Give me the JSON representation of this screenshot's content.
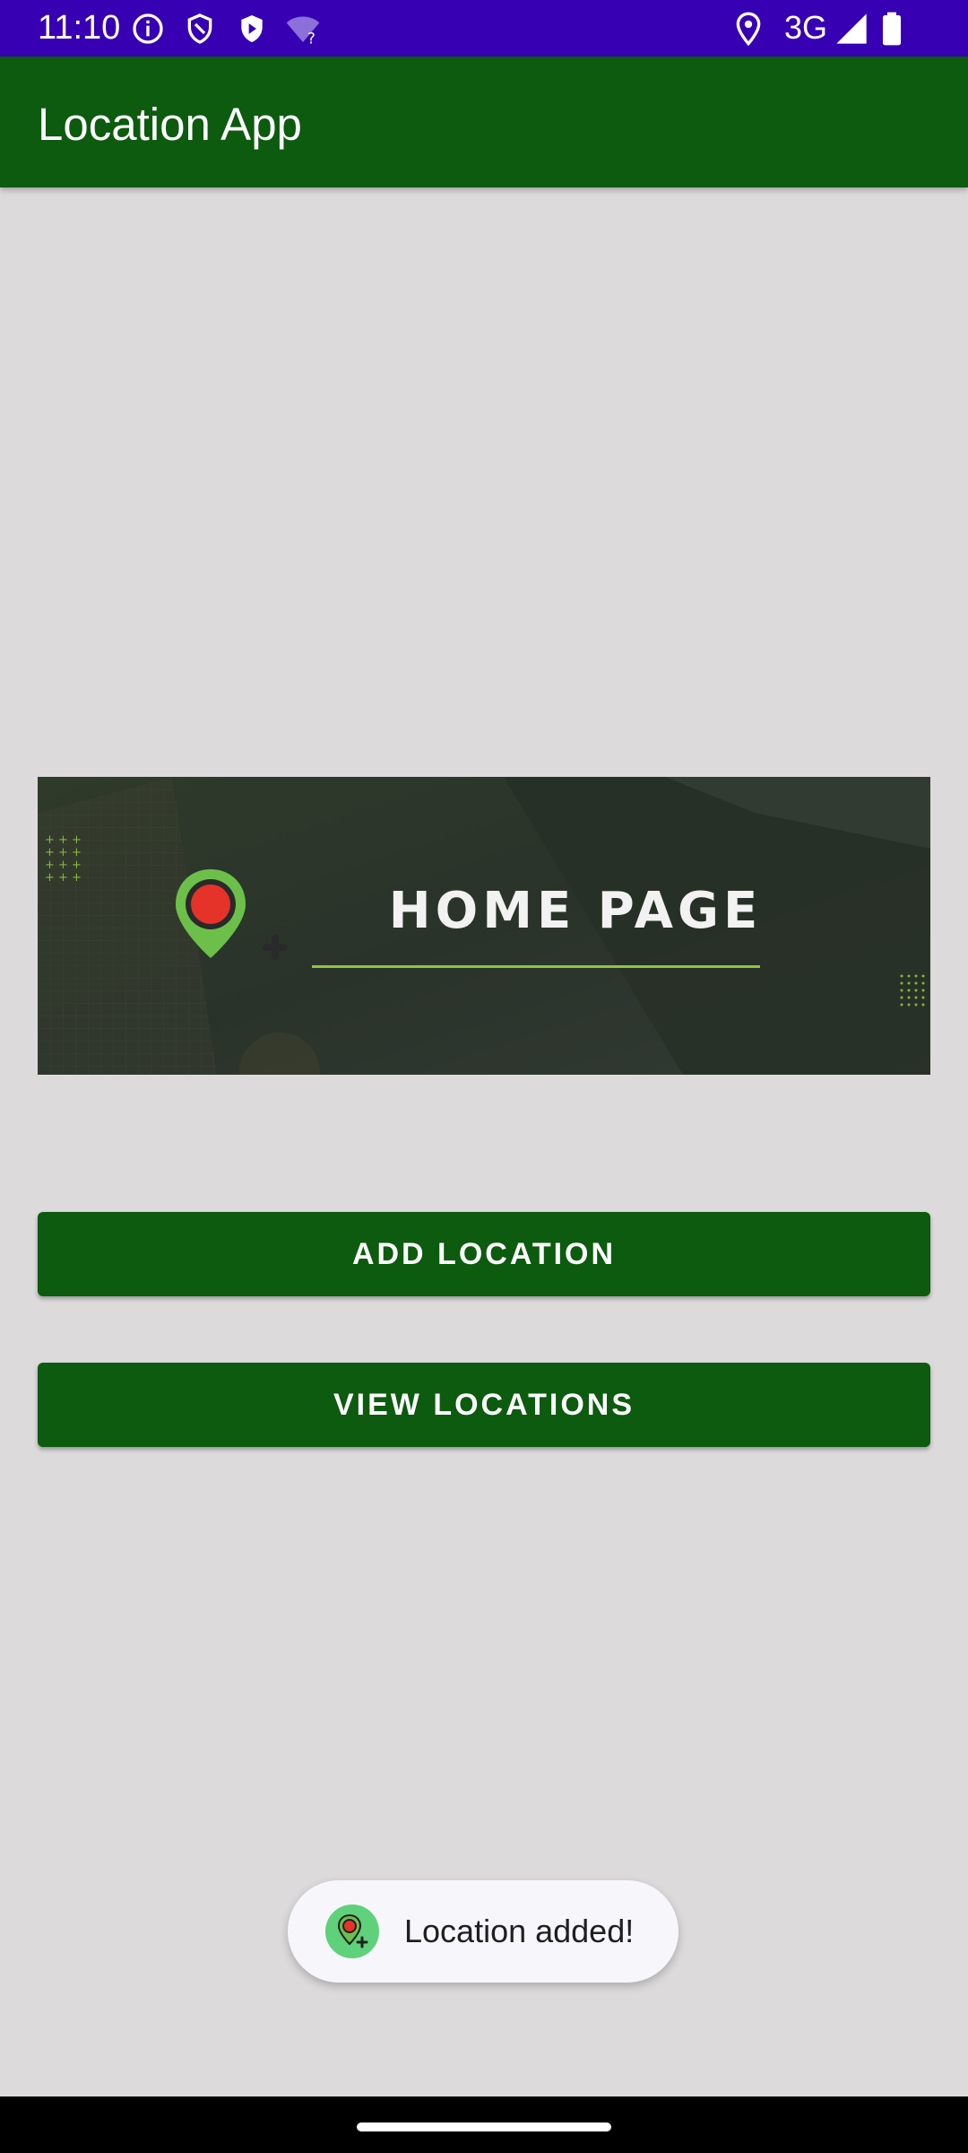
{
  "status_bar": {
    "time": "11:10",
    "network": "3G",
    "icons": [
      "info-icon",
      "shield-icon",
      "shield-play-icon",
      "wifi-unknown-icon",
      "location-icon",
      "signal-icon",
      "battery-icon"
    ]
  },
  "app_bar": {
    "title": "Location App"
  },
  "banner": {
    "title": "HOME PAGE",
    "icon": "map-pin-icon"
  },
  "buttons": {
    "add_location": "ADD LOCATION",
    "view_locations": "VIEW LOCATIONS"
  },
  "toast": {
    "message": "Location added!",
    "icon": "location-add-icon"
  },
  "colors": {
    "status_bar": "#3700b3",
    "primary": "#0c5b0f",
    "background": "#dcdadb",
    "accent_green": "#8cc63f",
    "pin_red": "#e5332a"
  }
}
